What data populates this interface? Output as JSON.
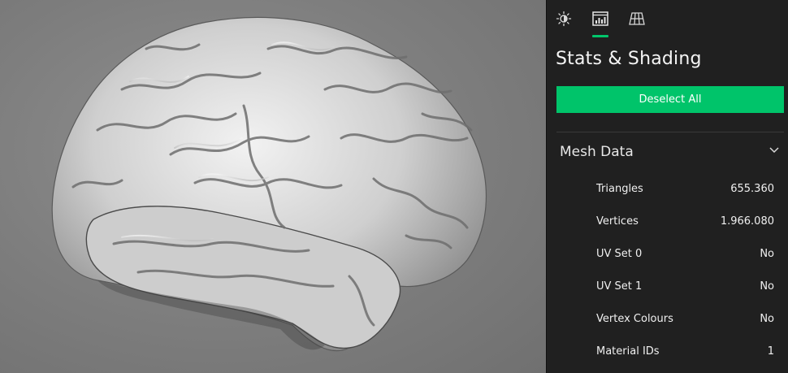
{
  "tabs": [
    {
      "icon": "sun-icon",
      "active": false
    },
    {
      "icon": "stats-chart-icon",
      "active": true
    },
    {
      "icon": "grid-icon",
      "active": false
    }
  ],
  "panel": {
    "title": "Stats & Shading",
    "deselect_label": "Deselect All"
  },
  "mesh_data": {
    "title": "Mesh Data",
    "rows": [
      {
        "label": "Triangles",
        "value": "655.360"
      },
      {
        "label": "Vertices",
        "value": "1.966.080"
      },
      {
        "label": "UV Set 0",
        "value": "No"
      },
      {
        "label": "UV Set 1",
        "value": "No"
      },
      {
        "label": "Vertex Colours",
        "value": "No"
      },
      {
        "label": "Material IDs",
        "value": "1"
      }
    ]
  },
  "colors": {
    "accent": "#00c46a",
    "panel_bg": "#202020",
    "viewport_bg": "#7d7d7d",
    "model": "#d9d9d9"
  }
}
